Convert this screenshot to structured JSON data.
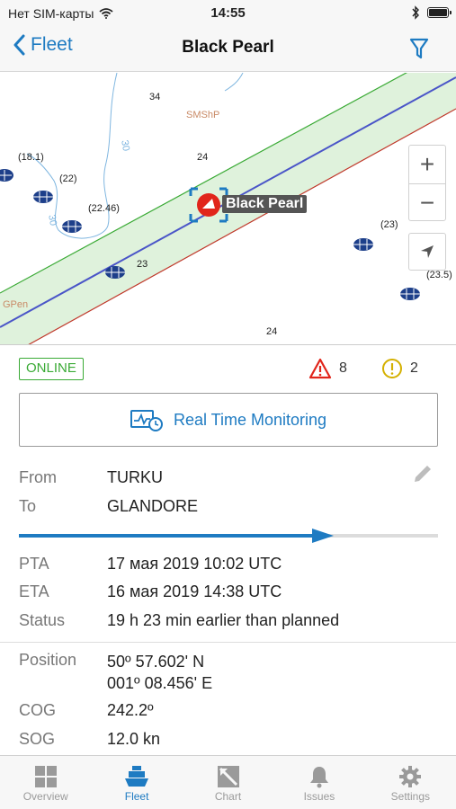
{
  "status_bar": {
    "carrier": "Нет SIM-карты",
    "time": "14:55"
  },
  "nav": {
    "back_label": "Fleet",
    "title": "Black Pearl"
  },
  "map": {
    "depths": [
      "34",
      "24",
      "(18.1)",
      "(22)",
      "(22.46)",
      "23",
      "(23)",
      "(23.5)",
      "24",
      "30",
      "30"
    ],
    "places": [
      "SMShP",
      "GPen"
    ],
    "vessel_label": "Black Pearl",
    "zoom_in": "+",
    "zoom_out": "−"
  },
  "status": {
    "online": "ONLINE",
    "alarms_count": "8",
    "warnings_count": "2",
    "alarm_color": "#e1251b",
    "warning_color": "#d4b000"
  },
  "rtm_button": "Real Time Monitoring",
  "voyage": {
    "from_label": "From",
    "from_value": "TURKU",
    "to_label": "To",
    "to_value": "GLANDORE",
    "progress": 0.75,
    "pta_label": "PTA",
    "pta_value": "17 мая 2019 10:02 UTC",
    "eta_label": "ETA",
    "eta_value": "16 мая 2019 14:38 UTC",
    "status_label": "Status",
    "status_value": "19 h 23 min earlier than planned"
  },
  "position": {
    "position_label": "Position",
    "lat": "50º 57.602' N",
    "lon": "001º 08.456' E",
    "cog_label": "COG",
    "cog_value": "242.2º",
    "sog_label": "SOG",
    "sog_value": "12.0 kn"
  },
  "tabs": [
    {
      "label": "Overview",
      "icon": "grid-icon"
    },
    {
      "label": "Fleet",
      "icon": "ship-icon"
    },
    {
      "label": "Chart",
      "icon": "chart-icon"
    },
    {
      "label": "Issues",
      "icon": "bell-icon"
    },
    {
      "label": "Settings",
      "icon": "gear-icon"
    }
  ],
  "colors": {
    "accent": "#1e7bc2",
    "online": "#3aaa35",
    "route": "#4a55c8",
    "corridor_left": "#3aaa35",
    "corridor_right": "#c0392b"
  }
}
